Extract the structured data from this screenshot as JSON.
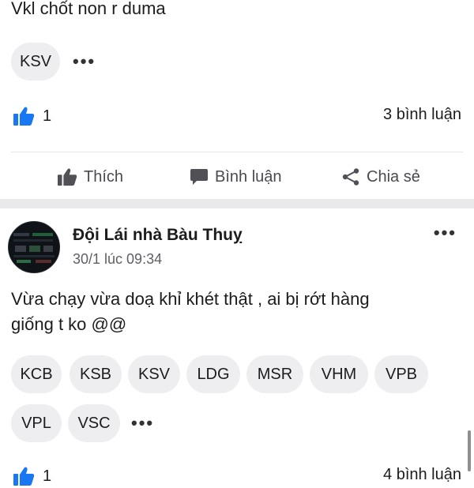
{
  "post1": {
    "text": "Vkl chốt non r duma",
    "tags": [
      "KSV"
    ],
    "likes": "1",
    "comments": "3 bình luận"
  },
  "actions": {
    "like": "Thích",
    "comment": "Bình luận",
    "share": "Chia sẻ"
  },
  "post2": {
    "author": "Đội Lái nhà Bàu Thuỵ",
    "time": "30/1 lúc 09:34",
    "text_line1": "Vừa chạy vừa doạ khỉ khét thật , ai bị rớt hàng",
    "text_line2": "giống t ko @@",
    "tags": [
      "KCB",
      "KSB",
      "KSV",
      "LDG",
      "MSR",
      "VHM",
      "VPB",
      "VPL",
      "VSC"
    ],
    "likes": "1",
    "comments": "4 bình luận"
  },
  "icons": {
    "more": "more-horizontal-icon",
    "like": "thumbs-up-icon",
    "comment": "speech-bubble-icon",
    "share": "share-icon"
  },
  "colors": {
    "accent": "#1877f2",
    "chip_bg": "#eeeef0",
    "divider": "#e6e6e8",
    "section_gap": "#e9e9ec"
  }
}
